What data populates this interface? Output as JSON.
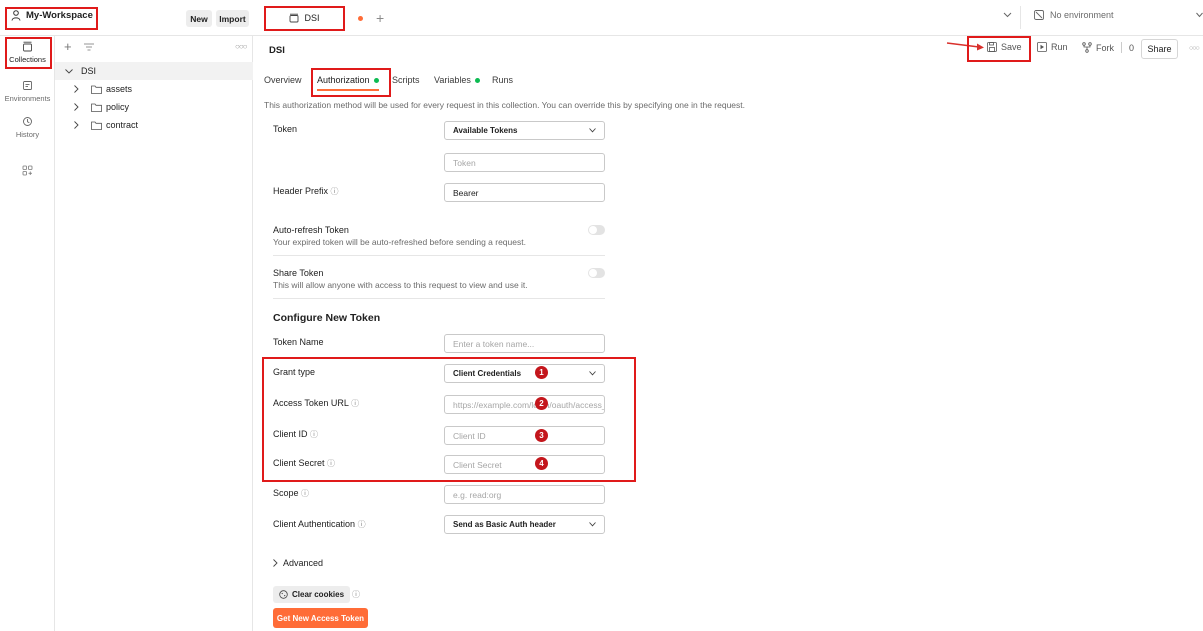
{
  "workspace": {
    "name": "My-Workspace",
    "new_label": "New",
    "import_label": "Import"
  },
  "tabs": {
    "active_tab": "DSI",
    "environment": "No environment"
  },
  "rail": [
    {
      "label": "Collections",
      "icon": "collections-icon"
    },
    {
      "label": "Environments",
      "icon": "environments-icon"
    },
    {
      "label": "History",
      "icon": "history-icon"
    }
  ],
  "tree": {
    "root": "DSI",
    "folders": [
      "assets",
      "policy",
      "contract"
    ]
  },
  "header": {
    "title": "DSI",
    "save_label": "Save",
    "run_label": "Run",
    "fork_label": "Fork",
    "fork_count": "0",
    "share_label": "Share"
  },
  "subtabs": {
    "overview": "Overview",
    "authorization": "Authorization",
    "scripts": "Scripts",
    "variables": "Variables",
    "runs": "Runs"
  },
  "auth": {
    "description": "This authorization method will be used for every request in this collection. You can override this by specifying one in the request.",
    "token_label": "Token",
    "token_select": "Available Tokens",
    "token_placeholder": "Token",
    "header_prefix_label": "Header Prefix",
    "header_prefix_value": "Bearer",
    "auto_refresh_title": "Auto-refresh Token",
    "auto_refresh_desc": "Your expired token will be auto-refreshed before sending a request.",
    "share_token_title": "Share Token",
    "share_token_desc": "This will allow anyone with access to this request to view and use it.",
    "configure_heading": "Configure New Token",
    "token_name_label": "Token Name",
    "token_name_placeholder": "Enter a token name...",
    "grant_type_label": "Grant type",
    "grant_type_value": "Client Credentials",
    "access_token_url_label": "Access Token URL",
    "access_token_url_placeholder": "https://example.com/login/oauth/access_token",
    "client_id_label": "Client ID",
    "client_id_placeholder": "Client ID",
    "client_secret_label": "Client Secret",
    "client_secret_placeholder": "Client Secret",
    "scope_label": "Scope",
    "scope_placeholder": "e.g. read:org",
    "client_auth_label": "Client Authentication",
    "client_auth_value": "Send as Basic Auth header",
    "advanced_label": "Advanced",
    "clear_cookies_label": "Clear cookies",
    "get_token_label": "Get New Access Token"
  },
  "annotations": {
    "n1": "1",
    "n2": "2",
    "n3": "3",
    "n4": "4"
  },
  "colors": {
    "accent": "#ff6c37",
    "annotation": "#e01a1a",
    "green": "#0cbb52"
  }
}
